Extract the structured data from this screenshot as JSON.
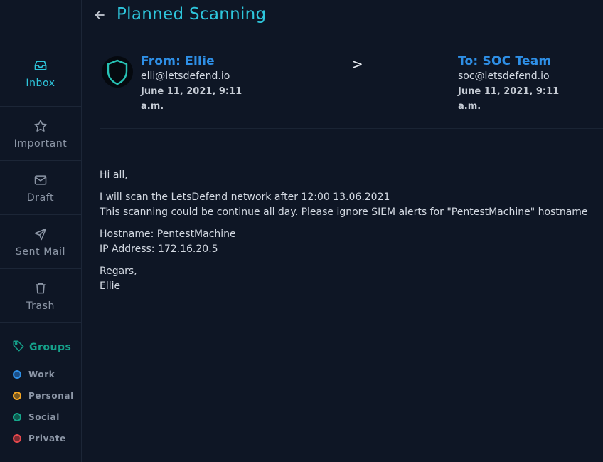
{
  "sidebar": {
    "items": [
      {
        "label": "Inbox",
        "icon": "inbox-icon",
        "active": true
      },
      {
        "label": "Important",
        "icon": "star-icon"
      },
      {
        "label": "Draft",
        "icon": "mail-icon"
      },
      {
        "label": "Sent Mail",
        "icon": "send-icon"
      },
      {
        "label": "Trash",
        "icon": "trash-icon"
      }
    ],
    "groups_title": "Groups",
    "groups": [
      {
        "label": "Work",
        "color": "#2e8fe6"
      },
      {
        "label": "Personal",
        "color": "#f5a623"
      },
      {
        "label": "Social",
        "color": "#16a88c"
      },
      {
        "label": "Private",
        "color": "#e5484d"
      }
    ]
  },
  "header": {
    "title": "Planned Scanning"
  },
  "email": {
    "from": {
      "name": "From: Ellie",
      "email": "elli@letsdefend.io",
      "date": "June 11, 2021, 9:11 a.m."
    },
    "arrow": ">",
    "to": {
      "name": "To: SOC Team",
      "email": "soc@letsdefend.io",
      "date": "June 11, 2021, 9:11 a.m."
    },
    "body": {
      "greeting": "Hi all,",
      "line1": "I will scan the LetsDefend network after 12:00 13.06.2021",
      "line2": "This scanning could be continue all day. Please ignore SIEM alerts for \"PentestMachine\" hostname",
      "hostname": "Hostname: PentestMachine",
      "ip": "IP Address: 172.16.20.5",
      "closing": "Regars,",
      "signature": "Ellie"
    }
  },
  "colors": {
    "accent": "#2ec6dc",
    "link": "#2e8fe6",
    "groups": "#15a18a",
    "background": "#0e1625"
  }
}
